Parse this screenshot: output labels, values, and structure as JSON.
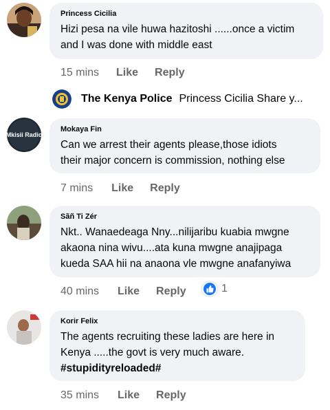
{
  "comments": [
    {
      "author": "Princess Cicilia",
      "lines": [
        "Hizi pesa na vile huwa hazitoshi ......once a victim",
        "and I was done with middle east"
      ],
      "time": "15 mins",
      "like": "Like",
      "reply": "Reply"
    },
    {
      "author": "Mokaya Fin",
      "avatar_text": "Mkisii Radio",
      "lines": [
        "Can we arrest their agents please,those idiots",
        "their major concern is commission, nothing else"
      ],
      "time": "7 mins",
      "like": "Like",
      "reply": "Reply"
    },
    {
      "author": "Sãñ Ti Zér",
      "lines": [
        "Nkt.. Wanaedeaga Nny...nilijaribu kuabia mwgne",
        "akaona nina wivu....ata kuna mwgne anajipaga",
        "kueda SAA hii na anaona vle mwgne anafanyiwa"
      ],
      "time": "40 mins",
      "like": "Like",
      "reply": "Reply",
      "reaction_count": "1"
    },
    {
      "author": "Korir Felix",
      "lines": [
        "The agents recruiting these ladies are here in",
        "Kenya .....the govt is very much aware."
      ],
      "hashtag": "#stupidityreloaded#",
      "time": "35 mins",
      "like": "Like",
      "reply": "Reply"
    }
  ],
  "reply_preview": {
    "name": "The Kenya Police",
    "text": "Princess Cicilia Share y..."
  },
  "colors": {
    "bubble": "#f0f2f5",
    "meta_text": "#65676b",
    "like_blue": "#1877f2"
  }
}
